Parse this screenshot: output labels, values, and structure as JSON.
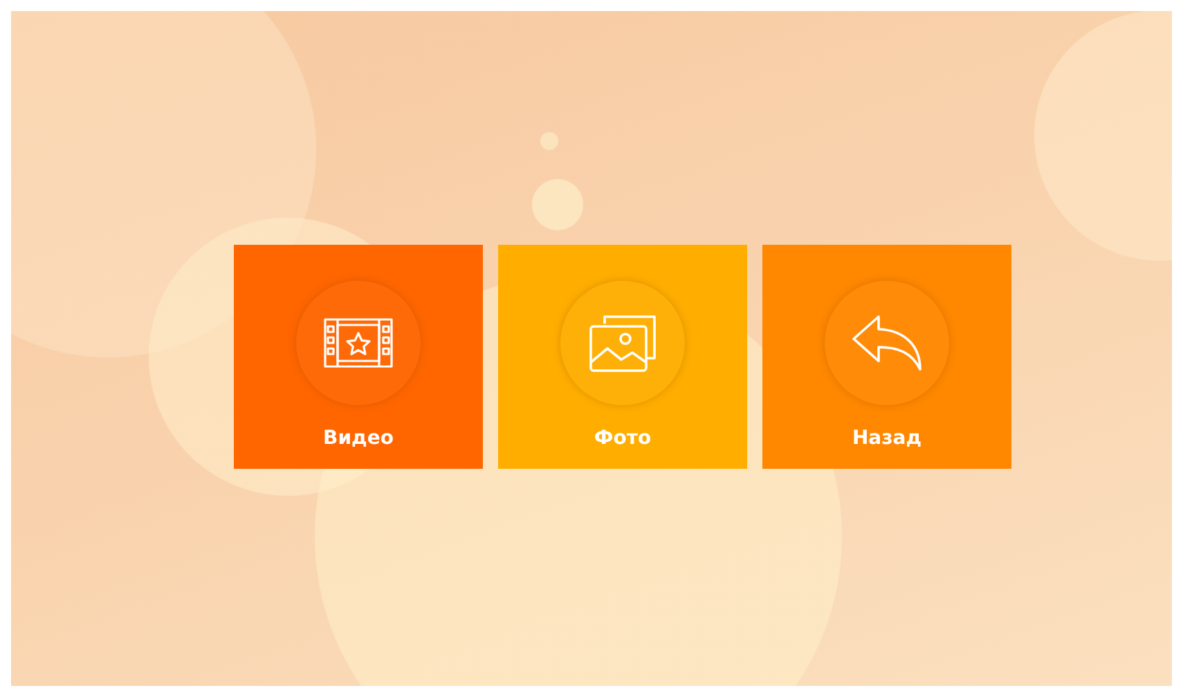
{
  "menu": [
    {
      "kind": "video",
      "label": "Видео",
      "color": "#ff6600"
    },
    {
      "kind": "photo",
      "label": "Фото",
      "color": "#ffae00"
    },
    {
      "kind": "back",
      "label": "Назад",
      "color": "#ff8800"
    }
  ]
}
